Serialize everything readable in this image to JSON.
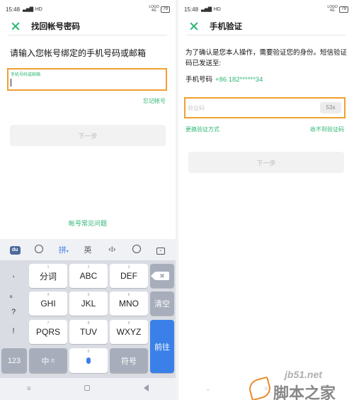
{
  "left": {
    "status": {
      "time": "15:48",
      "signal": "▃▅▇",
      "network": "HD",
      "lte": "LOGO 4G",
      "battery": "79"
    },
    "title": "找回帐号密码",
    "prompt": "请输入您帐号绑定的手机号码或邮箱",
    "field_label": "手机号码或邮箱",
    "forgot_link": "忘记帐号",
    "next_button": "下一步",
    "faq_link": "帐号常见问题"
  },
  "keyboard": {
    "toolbar": {
      "logo": "du",
      "pinyin": "拼",
      "english": "英",
      "cursor": "‹I›"
    },
    "punct": [
      ",",
      "。",
      "?",
      "!"
    ],
    "rows": [
      [
        {
          "num": "1",
          "label": "分词"
        },
        {
          "num": "2",
          "label": "ABC"
        },
        {
          "num": "3",
          "label": "DEF"
        }
      ],
      [
        {
          "num": "4",
          "label": "GHI"
        },
        {
          "num": "5",
          "label": "JKL"
        },
        {
          "num": "6",
          "label": "MNO"
        }
      ],
      [
        {
          "num": "7",
          "label": "PQRS"
        },
        {
          "num": "8",
          "label": "TUV"
        },
        {
          "num": "9",
          "label": "WXYZ"
        }
      ]
    ],
    "backspace": "✖",
    "clear": "清空",
    "enter": "前往",
    "mode_123": "123",
    "mode_cn": "中",
    "mode_cn_sub": "英",
    "space_num": "0",
    "symbol": "符号"
  },
  "navbar": {
    "menu": "≡",
    "back": ""
  },
  "right": {
    "status": {
      "time": "15:48",
      "signal": "▃▅▇",
      "network": "HD",
      "lte": "LOGO 4G",
      "battery": "79"
    },
    "title": "手机验证",
    "description": "为了确认是您本人操作，需要验证您的身份。短信验证码已发送至:",
    "phone_label": "手机号码",
    "phone_number": "+86 182******34",
    "code_placeholder": "验证码",
    "timer": "53s",
    "switch_method": "更换验证方式",
    "no_code": "收不到验证码",
    "next_button": "下一步"
  },
  "watermark": {
    "url": "jb51.net",
    "name": "脚本之家"
  },
  "colors": {
    "accent": "#2bb673",
    "highlight": "#f0a030",
    "key_blue": "#3a80e8"
  },
  "icons": [
    "close-icon",
    "emoji-icon",
    "cursor-icon",
    "search-icon",
    "keyboard-hide-icon",
    "backspace-icon",
    "mic-icon",
    "menu-icon",
    "home-icon",
    "back-icon"
  ]
}
